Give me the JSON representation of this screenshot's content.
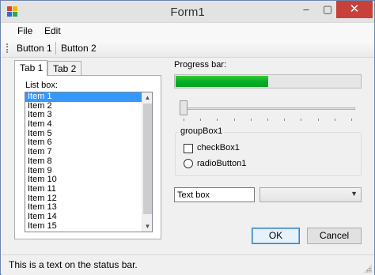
{
  "window": {
    "title": "Form1",
    "min_glyph": "–",
    "max_glyph": "▢",
    "close_glyph": "✕",
    "icon": "app-icon"
  },
  "menu": {
    "items": [
      {
        "label": "File"
      },
      {
        "label": "Edit"
      }
    ]
  },
  "toolbar": {
    "buttons": [
      {
        "label": "Button 1"
      },
      {
        "label": "Button 2"
      }
    ]
  },
  "tabs": [
    {
      "label": "Tab 1",
      "active": true
    },
    {
      "label": "Tab 2",
      "active": false
    }
  ],
  "listbox": {
    "label": "List box:",
    "items": [
      "Item 1",
      "Item 2",
      "Item 3",
      "Item 4",
      "Item 5",
      "Item 6",
      "Item 7",
      "Item 8",
      "Item 9",
      "Item 10",
      "Item 11",
      "Item 12",
      "Item 13",
      "Item 14",
      "Item 15"
    ],
    "selected_index": 0,
    "scroll_up_glyph": "▲",
    "scroll_down_glyph": "▼"
  },
  "progress": {
    "label": "Progress bar:",
    "value": 0.5
  },
  "trackbar": {
    "value": 0,
    "ticks": 11
  },
  "groupbox": {
    "title": "groupBox1",
    "checkbox_label": "checkBox1",
    "checkbox_checked": false,
    "radio_label": "radioButton1",
    "radio_checked": false
  },
  "textbox": {
    "value": "Text box"
  },
  "combobox": {
    "value": "",
    "arrow_glyph": "▼"
  },
  "buttons": {
    "ok": "OK",
    "cancel": "Cancel"
  },
  "status": {
    "text": "This is a text on the status bar."
  },
  "colors": {
    "progress_fill": "#06b025",
    "selection": "#3399ff",
    "close_button": "#c7413a"
  }
}
